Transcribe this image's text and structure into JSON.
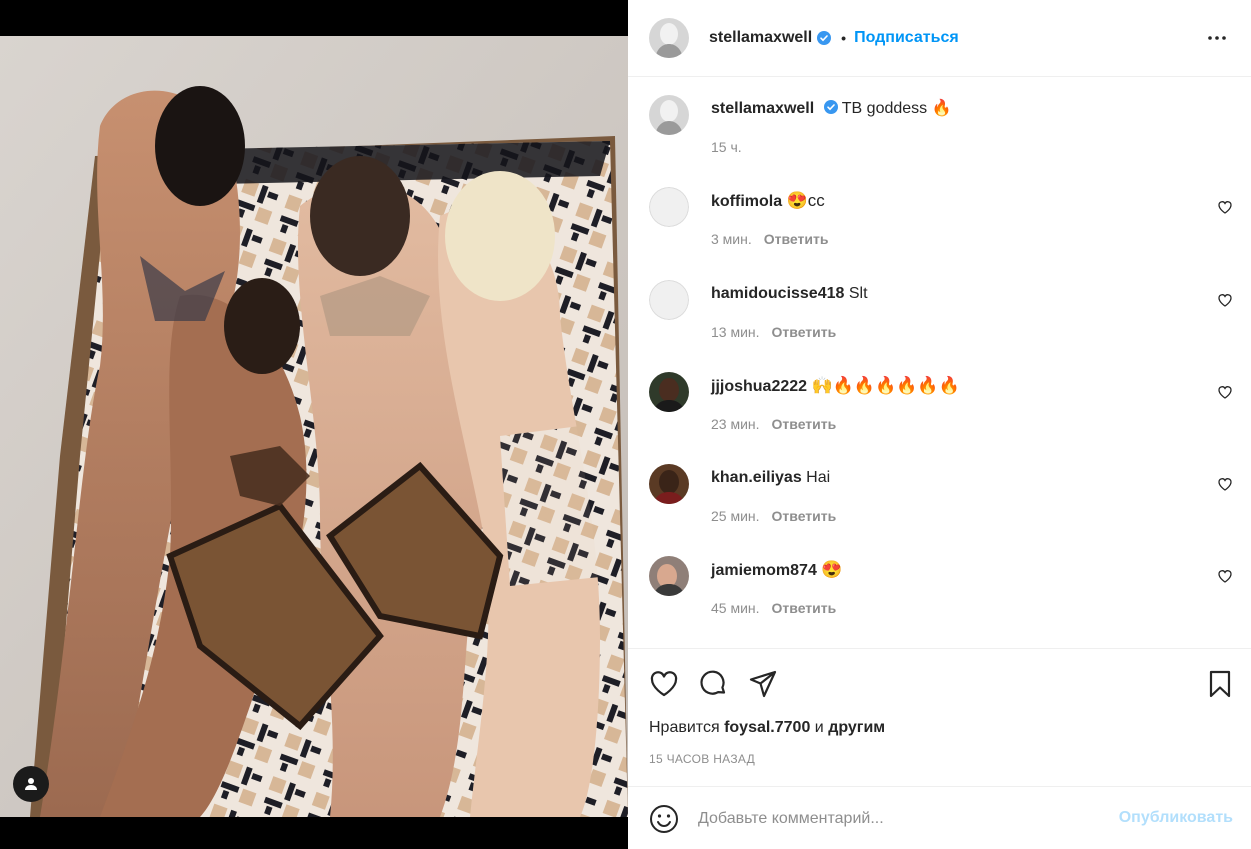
{
  "post": {
    "author": "stellamaxwell",
    "follow_label": "Подписаться",
    "dot": "•",
    "caption": "TB goddess 🔥",
    "caption_time": "15 ч.",
    "more_icon": "more-horizontal-icon",
    "photo_alt": "photo"
  },
  "comments": [
    {
      "user": "koffimola",
      "text": "😍cc",
      "time": "3 мин.",
      "reply": "Ответить",
      "avatar": "default"
    },
    {
      "user": "hamidoucisse418",
      "text": "Slt",
      "time": "13 мин.",
      "reply": "Ответить",
      "avatar": "default"
    },
    {
      "user": "jjjoshua2222",
      "text": "🙌🔥🔥🔥🔥🔥🔥",
      "time": "23 мин.",
      "reply": "Ответить",
      "avatar": "photo"
    },
    {
      "user": "khan.eiliyas",
      "text": "Hai",
      "time": "25 мин.",
      "reply": "Ответить",
      "avatar": "photo"
    },
    {
      "user": "jamiemom874",
      "text": "😍",
      "time": "45 мин.",
      "reply": "Ответить",
      "avatar": "photo"
    }
  ],
  "actions": {
    "likes_prefix": "Нравится",
    "likes_user": "foysal.7700",
    "likes_and": "и",
    "likes_others": "другим",
    "posted_ago": "15 ЧАСОВ НАЗАД"
  },
  "add_comment": {
    "placeholder": "Добавьте комментарий...",
    "publish_label": "Опубликовать"
  },
  "colors": {
    "accent": "#0095f6",
    "publish_disabled": "#b2dffc",
    "muted": "#8e8e8e",
    "text": "#262626"
  }
}
